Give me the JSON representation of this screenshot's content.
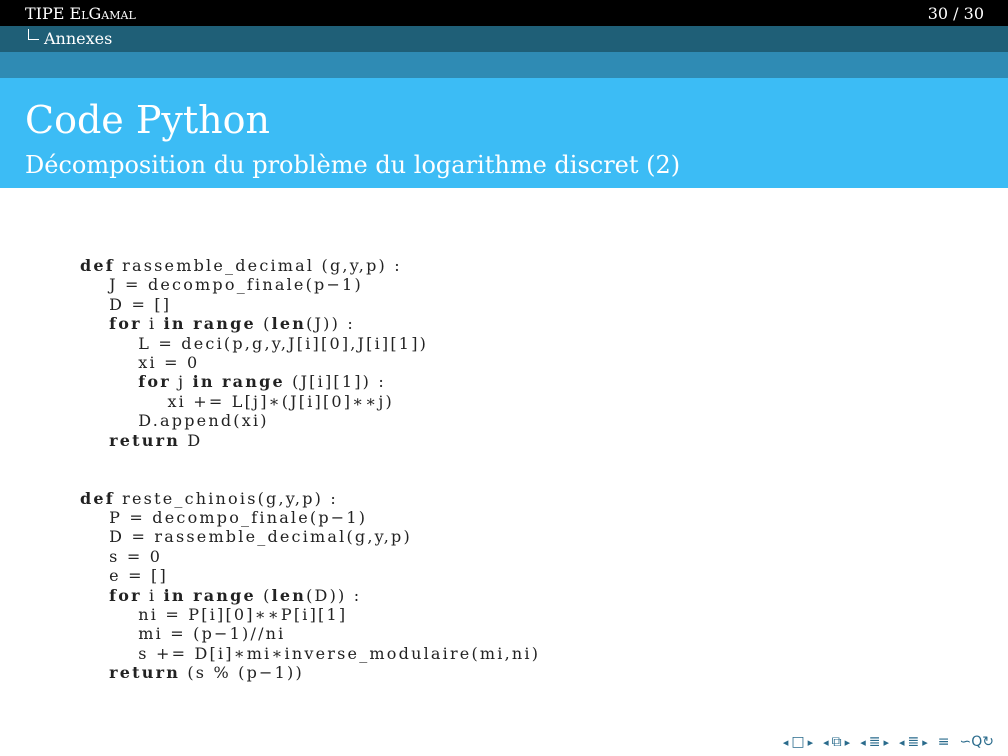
{
  "header": {
    "title_part1": "TIPE ",
    "title_part2": "ElGamal",
    "page_counter": "30 / 30",
    "section": "Annexes"
  },
  "slide": {
    "title": "Code Python",
    "subtitle": "Décomposition du problème du logarithme discret (2)"
  },
  "code": {
    "block1": [
      {
        "kw": "def",
        "text": " rassemble_decimal (g,y,p) :"
      },
      {
        "indent": "    ",
        "text": "J = decompo_finale(p−1)"
      },
      {
        "indent": "    ",
        "text": "D = []"
      },
      {
        "indent": "    ",
        "kw": "for",
        "text": " i ",
        "kw2": "in",
        "text2": " ",
        "kw3": "range",
        "text3": " (",
        "kw4": "len",
        "text4": "(J)) :"
      },
      {
        "indent": "        ",
        "text": "L = deci(p,g,y,J[i][0],J[i][1])"
      },
      {
        "indent": "        ",
        "text": "xi = 0"
      },
      {
        "indent": "        ",
        "kw": "for",
        "text": " j ",
        "kw2": "in",
        "text2": " ",
        "kw3": "range",
        "text3": " (J[i][1]) :"
      },
      {
        "indent": "            ",
        "text": "xi += L[j]∗(J[i][0]∗∗j)"
      },
      {
        "indent": "        ",
        "text": "D.append(xi)"
      },
      {
        "indent": "    ",
        "kw": "return",
        "text": " D"
      }
    ],
    "block2": [
      {
        "kw": "def",
        "text": " reste_chinois(g,y,p) :"
      },
      {
        "indent": "    ",
        "text": "P = decompo_finale(p−1)"
      },
      {
        "indent": "    ",
        "text": "D = rassemble_decimal(g,y,p)"
      },
      {
        "indent": "    ",
        "text": "s = 0"
      },
      {
        "indent": "    ",
        "text": "e = []"
      },
      {
        "indent": "    ",
        "kw": "for",
        "text": " i ",
        "kw2": "in",
        "text2": " ",
        "kw3": "range",
        "text3": " (",
        "kw4": "len",
        "text4": "(D)) :"
      },
      {
        "indent": "        ",
        "text": "ni = P[i][0]∗∗P[i][1]"
      },
      {
        "indent": "        ",
        "text": "mi = (p−1)//ni"
      },
      {
        "indent": "        ",
        "text": "s += D[i]∗mi∗inverse_modulaire(mi,ni)"
      },
      {
        "indent": "    ",
        "kw": "return",
        "text": " (s % (p−1))"
      }
    ]
  },
  "navigation": {
    "icons": [
      "nav-frame-icon",
      "nav-subsection-icon",
      "nav-section-icon",
      "nav-document-icon",
      "nav-align-icon",
      "nav-search-icon"
    ],
    "glyphs": {
      "left": "◂",
      "right": "▸",
      "frame": "□",
      "subsection": "⧉",
      "section": "≣",
      "align": "≡",
      "search": "∽Q↻"
    }
  }
}
